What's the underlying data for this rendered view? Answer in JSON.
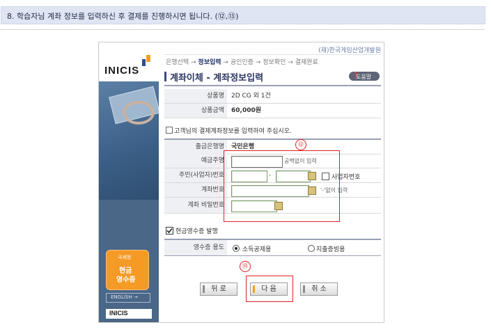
{
  "instruction": {
    "text": "8. 학습자님 계좌 정보를 입력하신 후 결제를 진행하시면 됩니다. (⑫,⑬)"
  },
  "brand": {
    "logo": "INICIS",
    "logo_bottom": "INICIS",
    "cash_receipt": {
      "small": "국세청",
      "line1": "현금",
      "line2": "영수증"
    },
    "english_button": "ENGLISH →"
  },
  "header": {
    "org": "(재)한국게임산업개발원",
    "steps": [
      "은행선택",
      "정보입력",
      "공인인증",
      "정보확인",
      "결제완료"
    ],
    "current_step": "정보입력",
    "arrow": "→",
    "title": "계좌이체 - 계좌정보입력",
    "help": "도움말"
  },
  "product": {
    "name_label": "상품명",
    "name_value": "2D CG 외 1건",
    "amount_label": "상품금액",
    "amount_value": "60,000원"
  },
  "form": {
    "section_title": "고객님의 결제계좌정보를 입력하여 주십시오.",
    "bank_label": "출금은행명",
    "bank_value": "국민은행",
    "depositor_label": "예금주명",
    "depositor_value": "",
    "depositor_hint": "공백없이 입력",
    "id_label": "주민(사업자)번호",
    "id_part1": "",
    "id_sep": "-",
    "id_part2": "",
    "business_checkbox_label": "사업자번호",
    "business_checked": false,
    "account_label": "계좌번호",
    "account_value": "",
    "account_hint": "'-'없이 입력",
    "password_label": "계좌 비밀번호",
    "password_value": ""
  },
  "receipt": {
    "issue_label": "현금영수증 발행",
    "issue_checked": true,
    "usage_label": "영수증 용도",
    "options": [
      "소득공제용",
      "지출증빙용"
    ],
    "selected": "소득공제용"
  },
  "buttons": {
    "back": "뒤 로",
    "next": "다 음",
    "cancel": "취 소"
  },
  "annotations": {
    "marker12": "⑫",
    "marker13": "⑬",
    "color": "#e02020"
  },
  "colors": {
    "header_bg": "#dfe5f3",
    "brand_left": "#4e6d8d",
    "accent": "#f0a020"
  }
}
